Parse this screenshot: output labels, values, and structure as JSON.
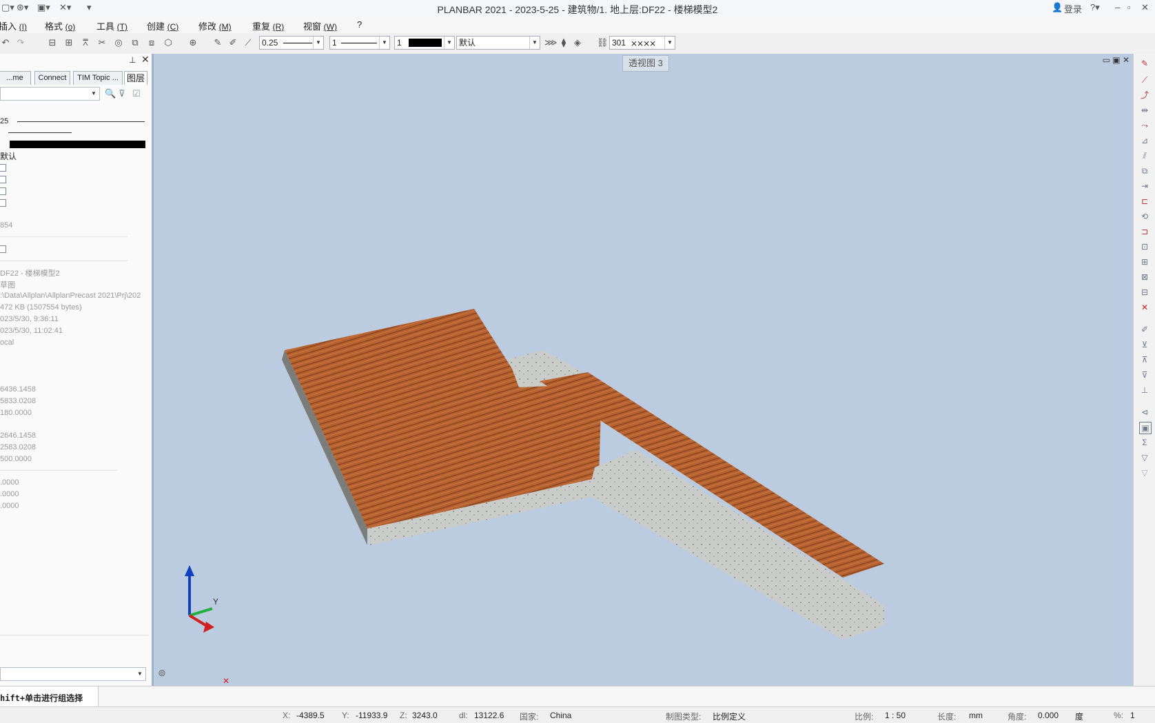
{
  "window": {
    "title": "PLANBAR 2021 - 2023-5-25 - 建筑物/1. 地上层:DF22 - 楼梯模型2",
    "login": "登录"
  },
  "menu": [
    {
      "label": "插入",
      "key": "(I)"
    },
    {
      "label": "格式",
      "key": "(o)"
    },
    {
      "label": "工具",
      "key": "(T)"
    },
    {
      "label": "创建",
      "key": "(C)"
    },
    {
      "label": "修改",
      "key": "(M)"
    },
    {
      "label": "重复",
      "key": "(R)"
    },
    {
      "label": "视窗",
      "key": "(W)"
    },
    {
      "label": "?",
      "key": ""
    }
  ],
  "toolbar": {
    "pen": "0.25",
    "line": "1",
    "color": "1",
    "layer": "默认",
    "hatch": "301"
  },
  "panel": {
    "tabs": [
      "...me Man...",
      "Connect",
      "TIM Topic ...",
      "图层"
    ],
    "pen_value": "25",
    "default_label": "默认",
    "id_value": "854",
    "file_title": "DF22 - 楼梯模型2",
    "file_type": "草图",
    "path": ":\\Data\\Allplan\\AllplanPrecast 2021\\Prj\\202",
    "size": "472 KB (1507554 bytes)",
    "created": "023/5/30, 9:36:11",
    "modified": "023/5/30, 11:02:41",
    "location": "ocal",
    "coords_a": [
      "6436.1458",
      "5833.0208",
      "180.0000"
    ],
    "coords_b": [
      "2646.1458",
      "2583.0208",
      "500.0000"
    ],
    "coords_c": [
      ".0000",
      ".0000",
      ".0000"
    ]
  },
  "viewport": {
    "label": "透视图 3",
    "axis_y": "Y"
  },
  "cmd": {
    "prompt": "hift+单击进行组选择"
  },
  "status": {
    "x_label": "X:",
    "x": "-4389.5",
    "y_label": "Y:",
    "y": "-11933.9",
    "z_label": "Z:",
    "z": "3243.0",
    "dl_label": "dl:",
    "dl": "13122.6",
    "country_label": "国家:",
    "country": "China",
    "drawtype_label": "制图类型:",
    "drawtype": "比例定义",
    "scale_label": "比例:",
    "scale": "1 : 50",
    "length_label": "长度:",
    "length": "mm",
    "angle_label": "角度:",
    "angle": "0.000",
    "angle_unit": "度",
    "pct_label": "%:",
    "pct": "1"
  }
}
